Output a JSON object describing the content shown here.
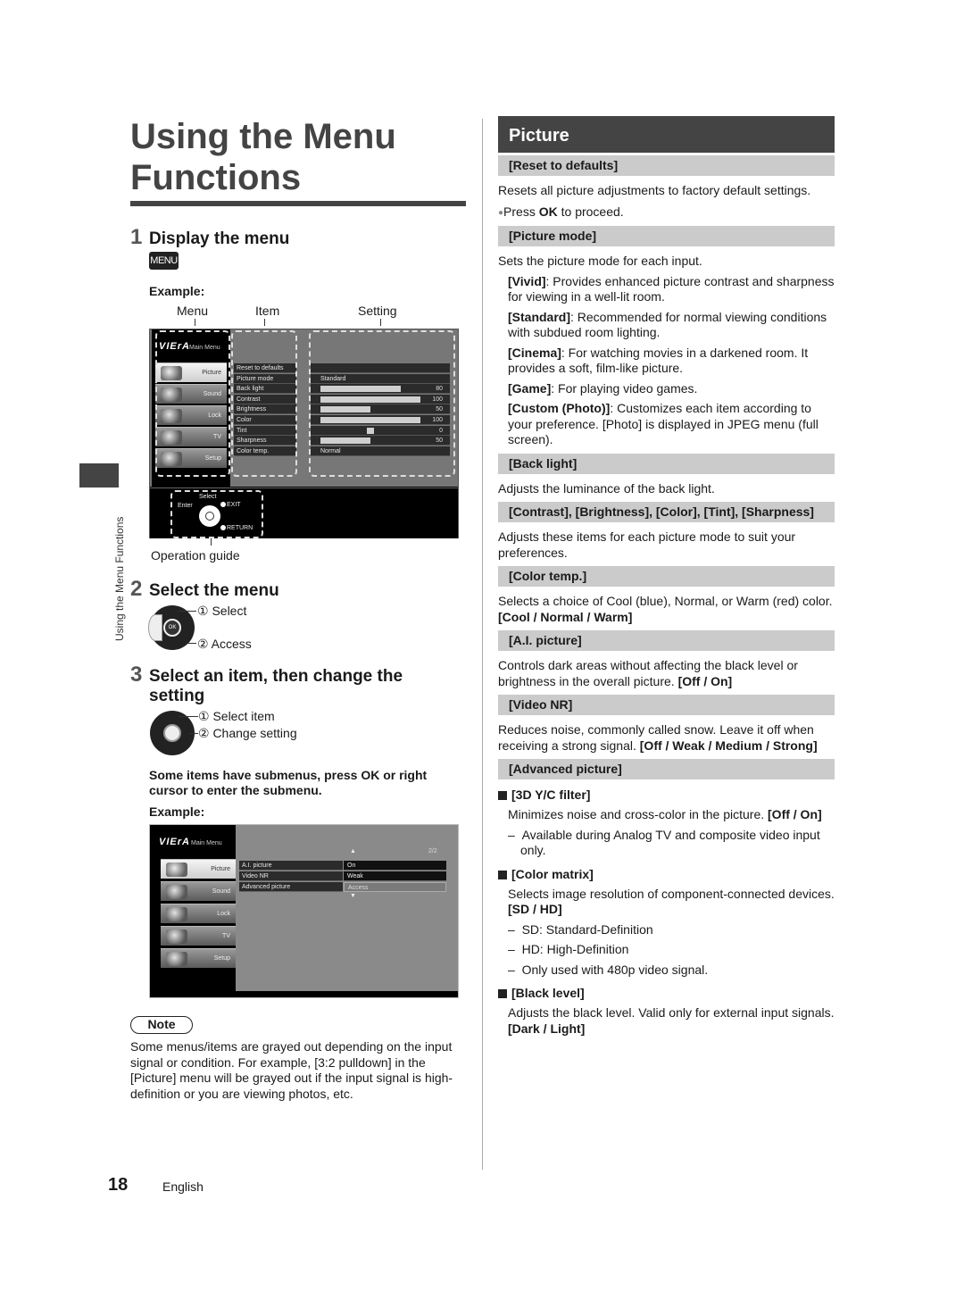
{
  "page": {
    "title": "Using the Menu Functions",
    "side_tab_label": "Using the Menu Functions",
    "page_number": "18",
    "language": "English"
  },
  "left": {
    "step1": {
      "num": "1",
      "title": "Display the menu",
      "key_label": "MENU"
    },
    "example_label": "Example:",
    "column_labels": {
      "menu": "Menu",
      "item": "Item",
      "setting": "Setting"
    },
    "screen1": {
      "logo": "VIErA",
      "main_menu_label": "Main Menu",
      "menus": [
        {
          "label": "Picture",
          "icon": "tv-icon",
          "active": true
        },
        {
          "label": "Sound",
          "icon": "music-note-icon",
          "active": false
        },
        {
          "label": "Lock",
          "icon": "padlock-icon",
          "active": false
        },
        {
          "label": "TV",
          "icon": "satellite-dish-icon",
          "active": false
        },
        {
          "label": "Setup",
          "icon": "wrench-icon",
          "active": false
        }
      ],
      "items": [
        {
          "label": "Reset to defaults",
          "setting_text": "",
          "value": null
        },
        {
          "label": "Picture mode",
          "setting_text": "Standard",
          "value": null
        },
        {
          "label": "Back light",
          "setting_text": "",
          "value": 80,
          "bar_fraction": 0.8
        },
        {
          "label": "Contrast",
          "setting_text": "",
          "value": 100,
          "bar_fraction": 1.0
        },
        {
          "label": "Brightness",
          "setting_text": "",
          "value": 50,
          "bar_fraction": 0.5
        },
        {
          "label": "Color",
          "setting_text": "",
          "value": 100,
          "bar_fraction": 1.0
        },
        {
          "label": "Tint",
          "setting_text": "",
          "value": 0,
          "bar_fraction": 0.0,
          "centered": true
        },
        {
          "label": "Sharpness",
          "setting_text": "",
          "value": 50,
          "bar_fraction": 0.5
        },
        {
          "label": "Color temp.",
          "setting_text": "Normal",
          "value": null
        }
      ],
      "op_guide": {
        "select": "Select",
        "enter": "Enter",
        "exit": "EXIT",
        "return": "RETURN"
      }
    },
    "op_guide_caption": "Operation guide",
    "step2": {
      "num": "2",
      "title": "Select the menu",
      "label1": "① Select",
      "label2": "② Access",
      "ok": "OK"
    },
    "step3": {
      "num": "3",
      "title": "Select an item, then change the setting",
      "label1": "① Select item",
      "label2": "② Change setting"
    },
    "submenu_note": "Some items have submenus, press OK or right cursor to enter the submenu.",
    "example_label2": "Example:",
    "screen2": {
      "logo": "VIErA",
      "main_menu_label": "Main Menu",
      "page_indicator": "2/2",
      "menus": [
        {
          "label": "Picture",
          "active": true
        },
        {
          "label": "Sound",
          "active": false
        },
        {
          "label": "Lock",
          "active": false
        },
        {
          "label": "TV",
          "active": false
        },
        {
          "label": "Setup",
          "active": false
        }
      ],
      "rows": [
        {
          "item": "A.I. picture",
          "value": "On",
          "focused": false
        },
        {
          "item": "Video NR",
          "value": "Weak",
          "focused": false
        },
        {
          "item": "Advanced picture",
          "value": "Access",
          "focused": true
        }
      ]
    },
    "note_label": "Note",
    "note_text": "Some menus/items are grayed out depending on the input signal or condition. For example, [3:2 pulldown] in the [Picture] menu will be grayed out if the input signal is high-definition or you are viewing photos, etc."
  },
  "right": {
    "section_title": "Picture",
    "reset": {
      "head": "[Reset to defaults]",
      "desc": "Resets all picture adjustments to factory default settings.",
      "bullet_pre": "Press ",
      "bullet_bold": "OK",
      "bullet_post": " to proceed."
    },
    "picture_mode": {
      "head": "[Picture mode]",
      "desc": "Sets the picture mode for each input.",
      "modes": [
        {
          "name": "[Vivid]",
          "text": ": Provides enhanced picture contrast and sharpness for viewing in a well-lit room."
        },
        {
          "name": "[Standard]",
          "text": ": Recommended for normal viewing conditions with subdued room lighting."
        },
        {
          "name": "[Cinema]",
          "text": ": For watching movies in a darkened room. It provides a soft, film-like picture."
        },
        {
          "name": "[Game]",
          "text": ": For playing video games."
        },
        {
          "name": "[Custom (Photo)]",
          "text": ": Customizes each item according to your preference. [Photo] is displayed in JPEG menu (full screen)."
        }
      ]
    },
    "back_light": {
      "head": "[Back light]",
      "desc": "Adjusts the luminance of the back light."
    },
    "adjustments": {
      "head": "[Contrast], [Brightness], [Color], [Tint], [Sharpness]",
      "desc": "Adjusts these items for each picture mode to suit your preferences."
    },
    "color_temp": {
      "head": "[Color temp.]",
      "desc": "Selects a choice of Cool (blue), Normal, or Warm (red) color. ",
      "options": "[Cool / Normal / Warm]"
    },
    "ai_picture": {
      "head": "[A.I. picture]",
      "desc": "Controls dark areas without affecting the black level or brightness in the overall picture. ",
      "options": "[Off / On]"
    },
    "video_nr": {
      "head": "[Video NR]",
      "desc": "Reduces noise, commonly called snow. Leave it off when receiving a strong signal. ",
      "options": "[Off / Weak / Medium / Strong]"
    },
    "advanced": {
      "head": "[Advanced picture]",
      "yc_filter": {
        "head": "[3D Y/C filter]",
        "desc": "Minimizes noise and cross-color in the picture. ",
        "options": "[Off / On]",
        "notes": [
          "Available during Analog TV and composite video input only."
        ]
      },
      "color_matrix": {
        "head": "[Color matrix]",
        "desc": "Selects image resolution of component-connected devices. ",
        "options": "[SD / HD]",
        "notes": [
          "SD: Standard-Definition",
          "HD: High-Definition",
          "Only used with 480p video signal."
        ]
      },
      "black_level": {
        "head": "[Black level]",
        "desc": "Adjusts the black level. Valid only for external input signals. ",
        "options": "[Dark / Light]"
      }
    }
  }
}
